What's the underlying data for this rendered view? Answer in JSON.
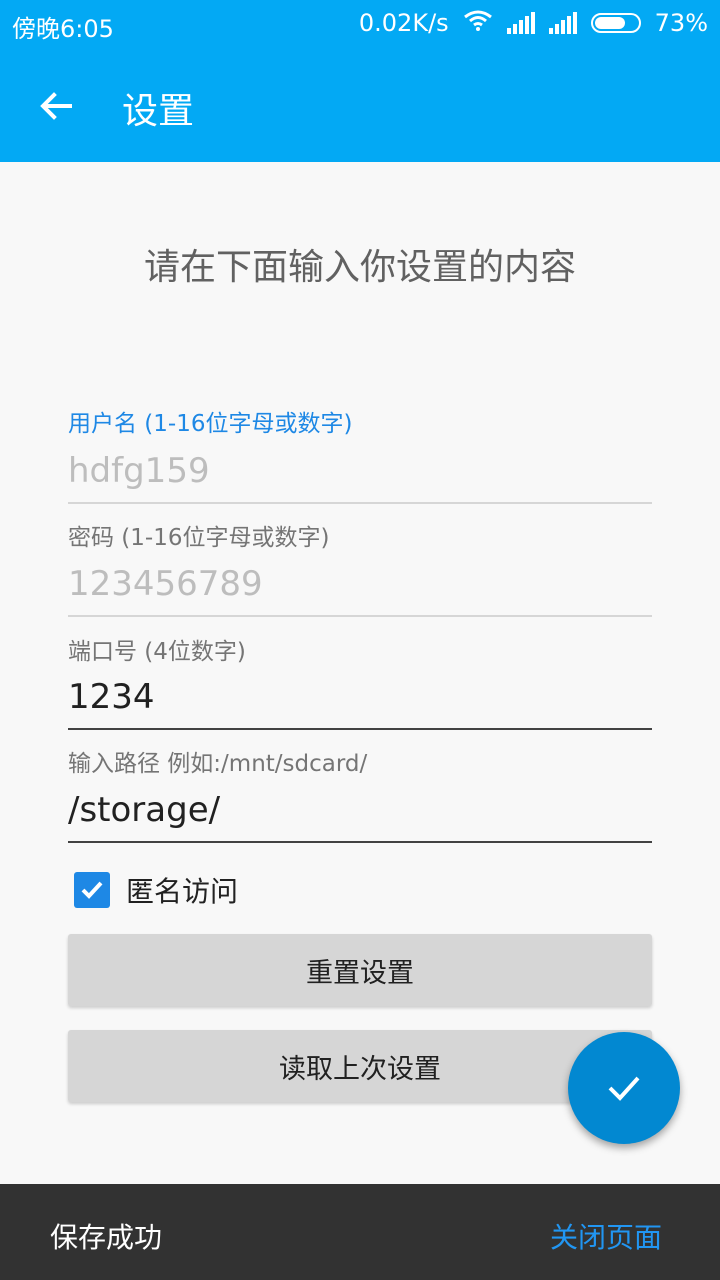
{
  "status_bar": {
    "time": "傍晚6:05",
    "speed": "0.02K/s",
    "battery": "73%",
    "battery_level": 0.73
  },
  "app_bar": {
    "title": "设置",
    "back_icon": "arrow-left-icon"
  },
  "heading": "请在下面输入你设置的内容",
  "form": {
    "username": {
      "label": "用户名 (1-16位字母或数字)",
      "value": "",
      "placeholder": "hdfg159"
    },
    "password": {
      "label": "密码 (1-16位字母或数字)",
      "value": "",
      "placeholder": "123456789"
    },
    "port": {
      "label": "端口号 (4位数字)",
      "value": "1234"
    },
    "path": {
      "label": "输入路径 例如:/mnt/sdcard/",
      "value": "/storage/"
    },
    "anonymous": {
      "label": "匿名访问",
      "checked": true
    }
  },
  "buttons": {
    "reset": "重置设置",
    "load_last": "读取上次设置"
  },
  "fab": {
    "icon": "check-icon"
  },
  "snackbar": {
    "message": "保存成功",
    "action": "关闭页面"
  },
  "colors": {
    "primary": "#03a9f4",
    "accent": "#1e88e5",
    "fab": "#0288d1",
    "snackbar": "#323232"
  }
}
